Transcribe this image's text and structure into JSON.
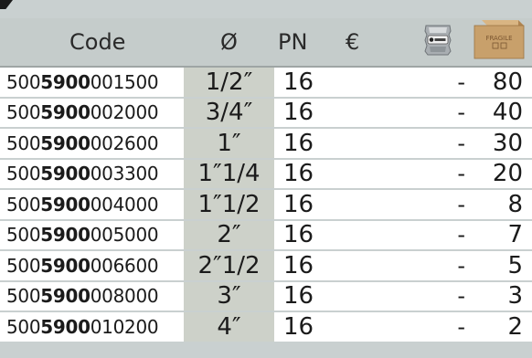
{
  "header": {
    "code": "Code",
    "diameter": "Ø",
    "pn": "PN",
    "price": "€",
    "bag_icon": "package-bag-icon",
    "box_icon": "fragile-box-icon",
    "box_label": "FRAGILE"
  },
  "rows": [
    {
      "code_prefix": "500",
      "code_bold": "5900",
      "code_suffix": "001500",
      "diameter": "1/2″",
      "pn": "16",
      "bag": "-",
      "box": "80"
    },
    {
      "code_prefix": "500",
      "code_bold": "5900",
      "code_suffix": "002000",
      "diameter": "3/4″",
      "pn": "16",
      "bag": "-",
      "box": "40"
    },
    {
      "code_prefix": "500",
      "code_bold": "5900",
      "code_suffix": "002600",
      "diameter": "1″",
      "pn": "16",
      "bag": "-",
      "box": "30"
    },
    {
      "code_prefix": "500",
      "code_bold": "5900",
      "code_suffix": "003300",
      "diameter": "1″1/4",
      "pn": "16",
      "bag": "-",
      "box": "20"
    },
    {
      "code_prefix": "500",
      "code_bold": "5900",
      "code_suffix": "004000",
      "diameter": "1″1/2",
      "pn": "16",
      "bag": "-",
      "box": "8"
    },
    {
      "code_prefix": "500",
      "code_bold": "5900",
      "code_suffix": "005000",
      "diameter": "2″",
      "pn": "16",
      "bag": "-",
      "box": "7"
    },
    {
      "code_prefix": "500",
      "code_bold": "5900",
      "code_suffix": "006600",
      "diameter": "2″1/2",
      "pn": "16",
      "bag": "-",
      "box": "5"
    },
    {
      "code_prefix": "500",
      "code_bold": "5900",
      "code_suffix": "008000",
      "diameter": "3″",
      "pn": "16",
      "bag": "-",
      "box": "3"
    },
    {
      "code_prefix": "500",
      "code_bold": "5900",
      "code_suffix": "010200",
      "diameter": "4″",
      "pn": "16",
      "bag": "-",
      "box": "2"
    }
  ],
  "colors": {
    "header_bg": "#c5cccb",
    "diameter_column_bg": "#cdd1c9",
    "row_bg": "#ffffff",
    "box_icon": "#c8a06b"
  }
}
